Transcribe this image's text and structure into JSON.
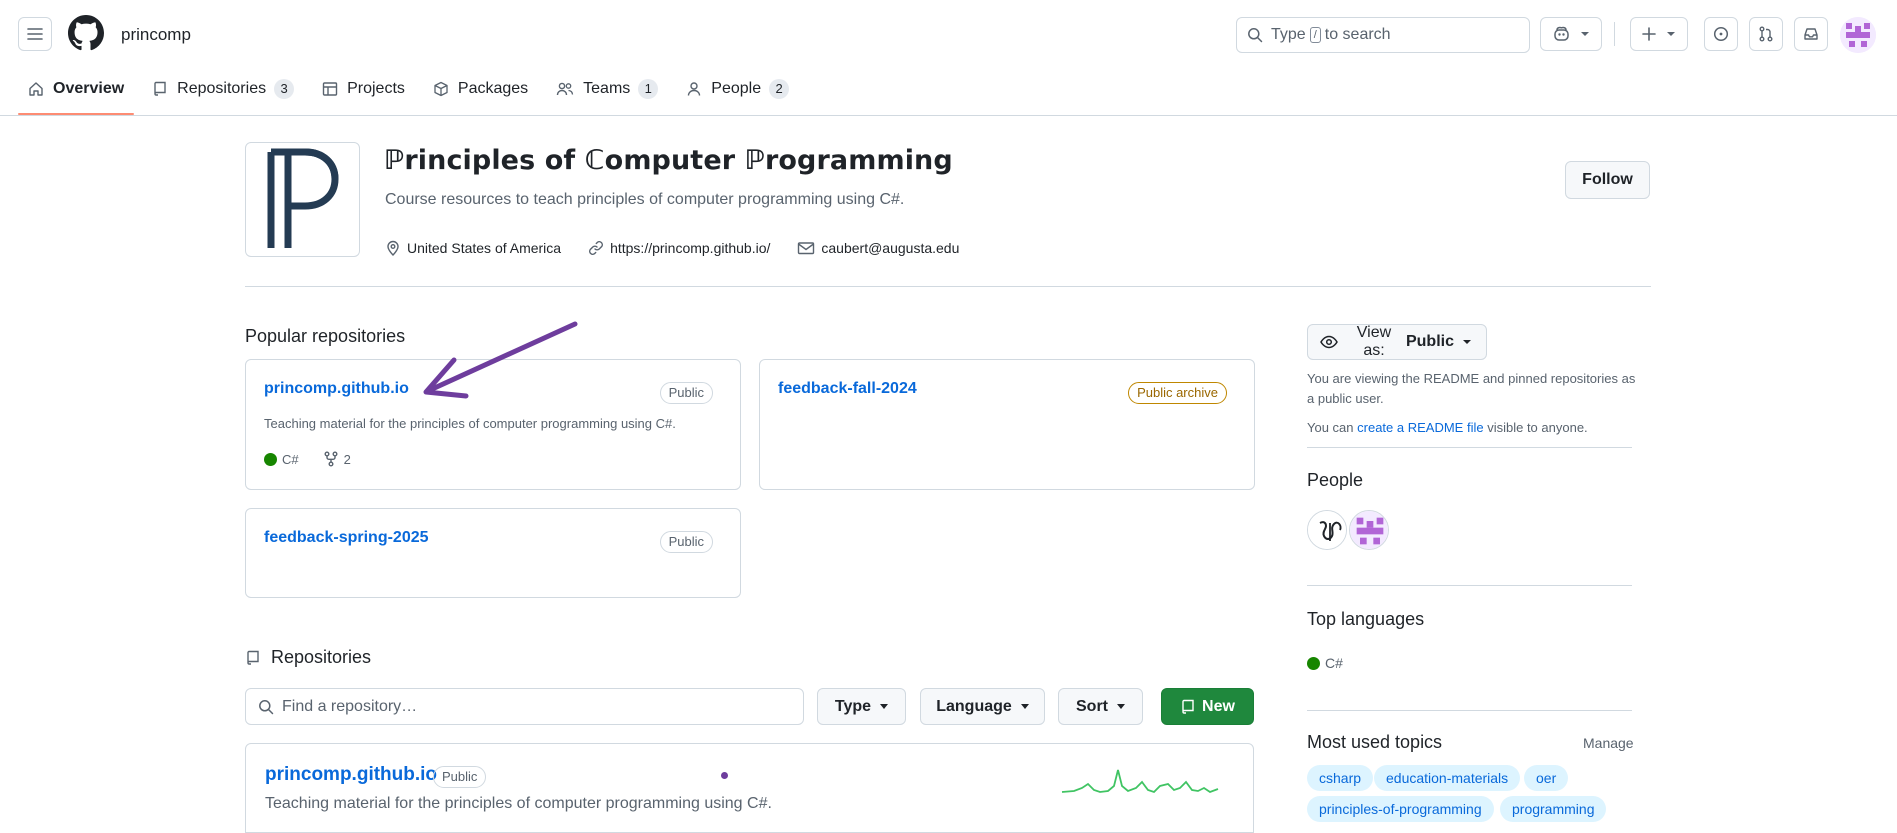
{
  "header": {
    "org_name": "princomp",
    "search_prefix": "Type",
    "search_key": "/",
    "search_suffix": "to search"
  },
  "tabs": [
    {
      "label": "Overview",
      "count": null
    },
    {
      "label": "Repositories",
      "count": "3"
    },
    {
      "label": "Projects",
      "count": null
    },
    {
      "label": "Packages",
      "count": null
    },
    {
      "label": "Teams",
      "count": "1"
    },
    {
      "label": "People",
      "count": "2"
    }
  ],
  "org": {
    "title": "ℙrinciples of ℂomputer ℙrogramming",
    "description": "Course resources to teach principles of computer programming using C#.",
    "location": "United States of America",
    "website": "https://princomp.github.io/",
    "email": "caubert@augusta.edu",
    "follow_label": "Follow"
  },
  "popular": {
    "title": "Popular repositories",
    "cards": [
      {
        "name": "princomp.github.io",
        "badge": "Public",
        "description": "Teaching material for the principles of computer programming using C#.",
        "language": "C#",
        "forks": "2"
      },
      {
        "name": "feedback-fall-2024",
        "badge": "Public archive"
      },
      {
        "name": "feedback-spring-2025",
        "badge": "Public"
      }
    ]
  },
  "repositories": {
    "title": "Repositories",
    "filter_placeholder": "Find a repository…",
    "type_label": "Type",
    "language_label": "Language",
    "sort_label": "Sort",
    "new_label": "New",
    "rows": [
      {
        "name": "princomp.github.io",
        "badge": "Public",
        "description": "Teaching material for the principles of computer programming using C#."
      }
    ]
  },
  "sidebar": {
    "view_as_label": "View as:",
    "view_as_value": "Public",
    "viewing_text": "You are viewing the README and pinned repositories as a public user.",
    "readme_prefix": "You can",
    "readme_link": "create a README file",
    "readme_suffix": "visible to anyone.",
    "people_title": "People",
    "top_languages_title": "Top languages",
    "top_language": "C#",
    "topics_title": "Most used topics",
    "manage_label": "Manage",
    "topics": [
      "csharp",
      "education-materials",
      "oer",
      "principles-of-programming",
      "programming"
    ]
  },
  "colors": {
    "accent": "#0969da",
    "tab_underline": "#fd8c73",
    "new_button": "#1f883d",
    "csharp": "#178600",
    "annotation_arrow": "#6e3d9d"
  }
}
